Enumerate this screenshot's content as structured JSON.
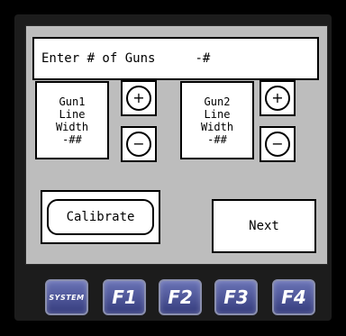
{
  "screen": {
    "entry": {
      "prompt": "Enter # of Guns",
      "value": "-#"
    },
    "gun1": {
      "line1": "Gun1",
      "line2": "Line",
      "line3": "Width",
      "value": "-##"
    },
    "gun2": {
      "line1": "Gun2",
      "line2": "Line",
      "line3": "Width",
      "value": "-##"
    },
    "increment_symbol": "+",
    "decrement_symbol": "−",
    "calibrate_label": "Calibrate",
    "next_label": "Next"
  },
  "keys": {
    "system": "SYSTEM",
    "f1": "F1",
    "f2": "F2",
    "f3": "F3",
    "f4": "F4"
  },
  "colors": {
    "screen_background": "#bdbdbd",
    "key_blue": "#4a529a",
    "bezel": "#1c1c1c"
  }
}
